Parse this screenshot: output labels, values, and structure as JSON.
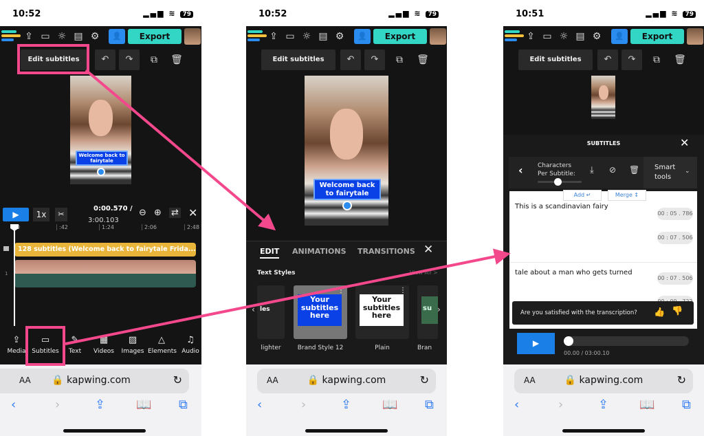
{
  "status_times": [
    "10:52",
    "10:52",
    "10:51"
  ],
  "battery": "79",
  "app": {
    "export_label": "Export",
    "edit_subtitles_label": "Edit subtitles"
  },
  "phone1": {
    "subtitle_preview": "Welcome back to fairytale",
    "playback_speed": "1x",
    "current_time": "0:00.570 /",
    "total_time": "3:00.103",
    "ruler": [
      "0",
      ":42",
      "1:24",
      "2:06",
      "2:48"
    ],
    "subtitle_track": "128 subtitles (Welcome back to fairytale Frida...",
    "track_number": "1",
    "tools": [
      {
        "label": "Media",
        "icon": "upload-icon"
      },
      {
        "label": "Subtitles",
        "icon": "subtitles-icon"
      },
      {
        "label": "Text",
        "icon": "text-icon"
      },
      {
        "label": "Videos",
        "icon": "videos-icon"
      },
      {
        "label": "Images",
        "icon": "images-icon"
      },
      {
        "label": "Elements",
        "icon": "elements-icon"
      },
      {
        "label": "Audio",
        "icon": "audio-icon"
      }
    ]
  },
  "phone2": {
    "subtitle_preview": "Welcome back to fairytale",
    "tabs": [
      "EDIT",
      "ANIMATIONS",
      "TRANSITIONS"
    ],
    "section_title": "Text Styles",
    "view_all": "View All >",
    "styles": [
      {
        "label": "lighter",
        "preview": "les"
      },
      {
        "label": "Brand Style 12",
        "preview": "Your subtitles here"
      },
      {
        "label": "Plain",
        "preview": "Your subtitles here"
      },
      {
        "label": "Bran",
        "preview": "su"
      }
    ]
  },
  "phone3": {
    "panel_title": "SUBTITLES",
    "chars_per_subtitle": "Characters Per Subtitle:",
    "chars_slider_fraction": 0.45,
    "smart_tools": "Smart tools",
    "add_label": "Add ↵",
    "merge_label": "Merge ↕",
    "subtitles": [
      {
        "text": "This is a scandinavian fairy",
        "start": "00 : 05 . 786",
        "end": "00 : 07 . 506"
      },
      {
        "text": "tale about a man who gets turned",
        "start": "00 : 07 . 506",
        "end": "00 : 09 . 722"
      }
    ],
    "feedback": "Are you satisfied with the transcription?",
    "time": "00.00 / 03:00.10",
    "progress_fraction": 0.0
  },
  "browser": {
    "aa": "AA",
    "url": "kapwing.com"
  },
  "colors": {
    "accent": "#33d6c4",
    "highlight": "#f4488d",
    "play": "#1a7fe6",
    "subtitle_track": "#e8b53a"
  }
}
